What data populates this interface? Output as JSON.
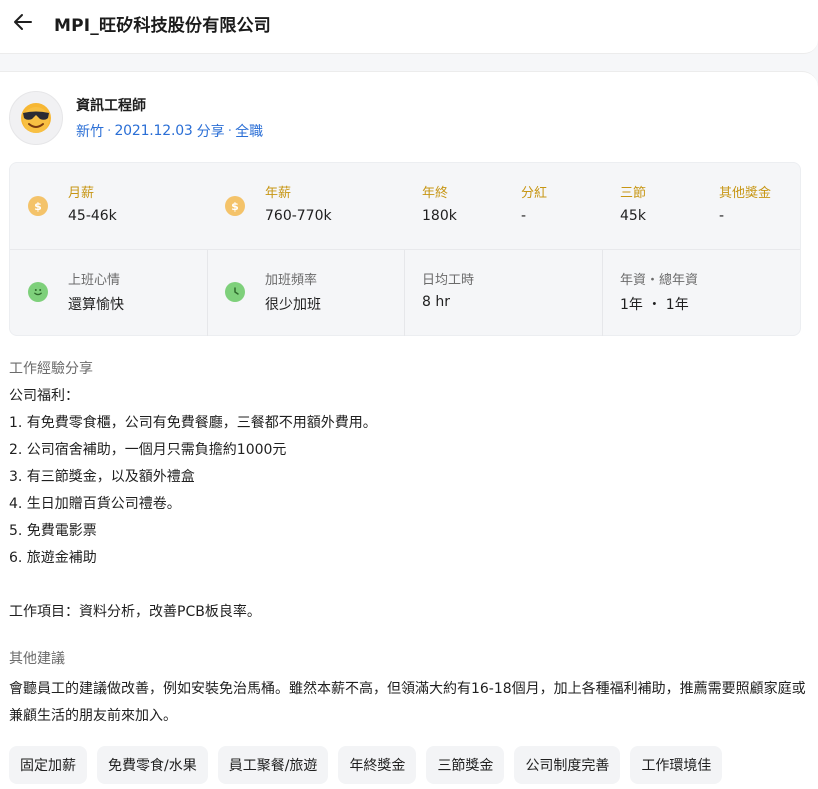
{
  "header": {
    "title": "MPI_旺矽科技股份有限公司",
    "back_icon": "arrow-left-icon"
  },
  "post": {
    "avatar_icon": "smiling-face-with-sunglasses-icon",
    "job_title": "資訊工程師",
    "location": "新竹",
    "date": "2021.12.03",
    "share_label": "分享",
    "employment_type": "全職",
    "separator": "·",
    "link_color": "#2b6fd6"
  },
  "stats": {
    "monthly_salary": {
      "label": "月薪",
      "value": "45-46k"
    },
    "annual_salary": {
      "label": "年薪",
      "value": "760-770k"
    },
    "year_end_bonus": {
      "label": "年終",
      "value": "180k"
    },
    "dividend": {
      "label": "分紅",
      "value": "-"
    },
    "festival_bonus": {
      "label": "三節",
      "value": "45k"
    },
    "other_bonus": {
      "label": "其他獎金",
      "value": "-"
    },
    "mood": {
      "label": "上班心情",
      "value": "還算愉快"
    },
    "overtime": {
      "label": "加班頻率",
      "value": "很少加班"
    },
    "daily_hours": {
      "label": "日均工時",
      "value": "8 hr"
    },
    "seniority": {
      "label": "年資・總年資",
      "value": "1年 ・ 1年"
    },
    "label_color_salary": "#c79614",
    "label_color_work": "#6b6b6b"
  },
  "experience": {
    "title": "工作經驗分享",
    "lines": [
      "公司福利：",
      "1. 有免費零食櫃，公司有免費餐廳，三餐都不用額外費用。",
      "2. 公司宿舍補助，一個月只需負擔約1000元",
      "3. 有三節獎金，以及額外禮盒",
      "4. 生日加贈百貨公司禮卷。",
      "5. 免費電影票",
      "6. 旅遊金補助",
      "工作項目：資料分析，改善PCB板良率。"
    ]
  },
  "advice": {
    "title": "其他建議",
    "text": "會聽員工的建議做改善，例如安裝免治馬桶。雖然本薪不高，但領滿大約有16-18個月，加上各種福利補助，推薦需要照顧家庭或兼顧生活的朋友前來加入。"
  },
  "tags": [
    "固定加薪",
    "免費零食/水果",
    "員工聚餐/旅遊",
    "年終獎金",
    "三節獎金",
    "公司制度完善",
    "工作環境佳"
  ]
}
